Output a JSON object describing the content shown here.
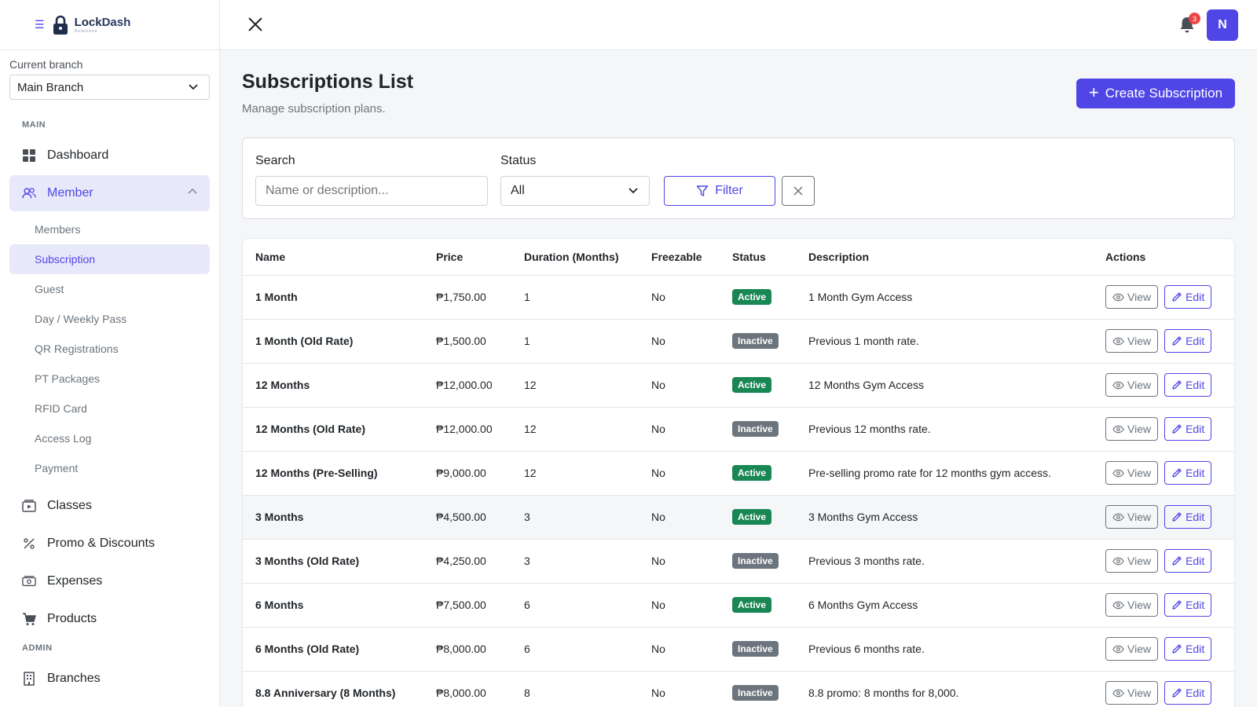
{
  "brand": {
    "name_part1": "Lock",
    "name_part2": "Dash",
    "subtitle": "Solutions"
  },
  "sidebar": {
    "branch_label": "Current branch",
    "branch_value": "Main Branch",
    "section_main": "MAIN",
    "section_admin": "ADMIN",
    "dashboard": "Dashboard",
    "member": "Member",
    "sub_items": [
      "Members",
      "Subscription",
      "Guest",
      "Day / Weekly Pass",
      "QR Registrations",
      "PT Packages",
      "RFID Card",
      "Access Log",
      "Payment"
    ],
    "classes": "Classes",
    "promo": "Promo & Discounts",
    "expenses": "Expenses",
    "products": "Products",
    "branches": "Branches"
  },
  "topbar": {
    "notification_count": "3",
    "avatar_initial": "N"
  },
  "page": {
    "title": "Subscriptions List",
    "subtitle": "Manage subscription plans.",
    "create_label": "Create Subscription"
  },
  "filters": {
    "search_label": "Search",
    "search_placeholder": "Name or description...",
    "status_label": "Status",
    "status_value": "All",
    "filter_label": "Filter"
  },
  "table": {
    "headers": [
      "Name",
      "Price",
      "Duration (Months)",
      "Freezable",
      "Status",
      "Description",
      "Actions"
    ],
    "view_label": "View",
    "edit_label": "Edit",
    "rows": [
      {
        "name": "1 Month",
        "price": "₱1,750.00",
        "duration": "1",
        "freezable": "No",
        "status": "Active",
        "description": "1 Month Gym Access"
      },
      {
        "name": "1 Month (Old Rate)",
        "price": "₱1,500.00",
        "duration": "1",
        "freezable": "No",
        "status": "Inactive",
        "description": "Previous 1 month rate."
      },
      {
        "name": "12 Months",
        "price": "₱12,000.00",
        "duration": "12",
        "freezable": "No",
        "status": "Active",
        "description": "12 Months Gym Access"
      },
      {
        "name": "12 Months (Old Rate)",
        "price": "₱12,000.00",
        "duration": "12",
        "freezable": "No",
        "status": "Inactive",
        "description": "Previous 12 months rate."
      },
      {
        "name": "12 Months (Pre-Selling)",
        "price": "₱9,000.00",
        "duration": "12",
        "freezable": "No",
        "status": "Active",
        "description": "Pre-selling promo rate for 12 months gym access."
      },
      {
        "name": "3 Months",
        "price": "₱4,500.00",
        "duration": "3",
        "freezable": "No",
        "status": "Active",
        "description": "3 Months Gym Access"
      },
      {
        "name": "3 Months (Old Rate)",
        "price": "₱4,250.00",
        "duration": "3",
        "freezable": "No",
        "status": "Inactive",
        "description": "Previous 3 months rate."
      },
      {
        "name": "6 Months",
        "price": "₱7,500.00",
        "duration": "6",
        "freezable": "No",
        "status": "Active",
        "description": "6 Months Gym Access"
      },
      {
        "name": "6 Months (Old Rate)",
        "price": "₱8,000.00",
        "duration": "6",
        "freezable": "No",
        "status": "Inactive",
        "description": "Previous 6 months rate."
      },
      {
        "name": "8.8 Anniversary (8 Months)",
        "price": "₱8,000.00",
        "duration": "8",
        "freezable": "No",
        "status": "Inactive",
        "description": "8.8 promo: 8 months for 8,000."
      }
    ]
  },
  "colors": {
    "accent": "#4f46e5",
    "active": "#198754",
    "inactive": "#6c757d"
  }
}
